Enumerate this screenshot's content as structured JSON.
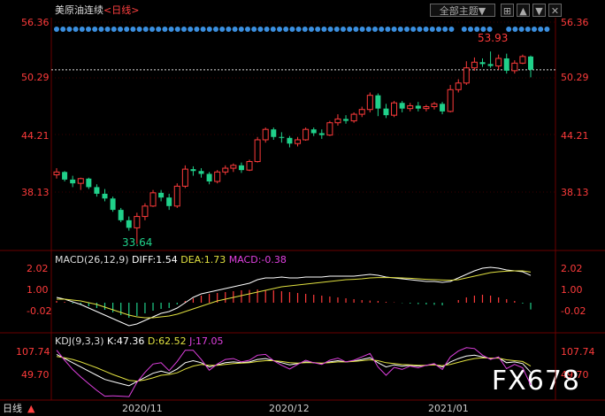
{
  "header": {
    "title": "美原油连续",
    "period": "<日线>",
    "theme_button": "全部主题▼",
    "buttons": [
      "⊞",
      "▲",
      "▼",
      "✕"
    ]
  },
  "axes": {
    "left": [
      "56.36",
      "50.29",
      "44.21",
      "38.13"
    ],
    "right": [
      "56.36",
      "50.29",
      "44.21",
      "38.13"
    ],
    "x_labels": [
      "2020/11",
      "2020/12",
      "2021/01"
    ]
  },
  "price": {
    "high_label": "53.93",
    "low_label": "33.64",
    "last": 52.0
  },
  "macd": {
    "title": "MACD(26,12,9)",
    "diff": "DIFF:1.54",
    "dea": "DEA:1.73",
    "macd": "MACD:-0.38",
    "left": [
      "2.02",
      "1.00",
      "-0.02"
    ],
    "right": [
      "2.02",
      "1.00",
      "-0.02"
    ]
  },
  "kdj": {
    "title": "KDJ(9,3,3)",
    "k": "K:47.36",
    "d": "D:62.52",
    "j": "J:17.05",
    "left": [
      "107.74",
      "49.70"
    ],
    "right": [
      "107.74",
      "49.70"
    ]
  },
  "footer": {
    "tab": "日线"
  },
  "watermark": "FX678",
  "colors": {
    "up": "#ff3b3b",
    "down": "#20d08a",
    "dots": "#3b8fe0",
    "k": "#ffffff",
    "d": "#e0e040",
    "j": "#e040e0"
  },
  "chart_data": {
    "type": "candlestick",
    "ylim": [
      33.0,
      57.5
    ],
    "candles": [
      [
        40.9,
        41.6,
        40.5,
        41.2
      ],
      [
        41.2,
        41.3,
        40.2,
        40.4
      ],
      [
        40.4,
        40.8,
        39.6,
        40.0
      ],
      [
        40.0,
        40.6,
        39.3,
        40.5
      ],
      [
        40.5,
        40.6,
        39.4,
        39.6
      ],
      [
        39.6,
        39.9,
        38.6,
        38.9
      ],
      [
        38.9,
        39.4,
        38.1,
        38.4
      ],
      [
        38.4,
        38.6,
        37.0,
        37.2
      ],
      [
        37.2,
        37.4,
        35.9,
        36.1
      ],
      [
        36.1,
        36.5,
        35.0,
        35.3
      ],
      [
        35.3,
        36.9,
        33.6,
        36.5
      ],
      [
        36.5,
        37.9,
        36.1,
        37.6
      ],
      [
        37.6,
        39.3,
        37.5,
        39.0
      ],
      [
        39.0,
        39.3,
        38.1,
        38.5
      ],
      [
        38.5,
        38.9,
        37.2,
        37.6
      ],
      [
        37.6,
        40.0,
        37.4,
        39.7
      ],
      [
        39.7,
        41.9,
        39.5,
        41.5
      ],
      [
        41.5,
        41.8,
        40.8,
        41.3
      ],
      [
        41.3,
        41.6,
        40.6,
        41.0
      ],
      [
        41.0,
        41.2,
        39.9,
        40.2
      ],
      [
        40.2,
        41.4,
        40.0,
        41.2
      ],
      [
        41.2,
        41.9,
        40.9,
        41.6
      ],
      [
        41.6,
        42.1,
        41.2,
        41.9
      ],
      [
        41.9,
        42.2,
        41.1,
        41.4
      ],
      [
        41.4,
        42.5,
        41.3,
        42.3
      ],
      [
        42.3,
        44.9,
        42.2,
        44.6
      ],
      [
        44.6,
        45.9,
        44.3,
        45.7
      ],
      [
        45.7,
        45.9,
        44.6,
        44.9
      ],
      [
        44.9,
        45.4,
        44.3,
        44.8
      ],
      [
        44.8,
        45.0,
        43.8,
        44.2
      ],
      [
        44.2,
        44.9,
        43.9,
        44.6
      ],
      [
        44.6,
        45.9,
        44.5,
        45.7
      ],
      [
        45.7,
        45.9,
        45.0,
        45.3
      ],
      [
        45.3,
        45.7,
        44.7,
        45.1
      ],
      [
        45.1,
        46.6,
        45.0,
        46.4
      ],
      [
        46.4,
        47.3,
        46.1,
        46.8
      ],
      [
        46.8,
        47.2,
        46.3,
        46.6
      ],
      [
        46.6,
        47.5,
        46.4,
        47.3
      ],
      [
        47.3,
        48.1,
        47.0,
        47.8
      ],
      [
        47.8,
        49.6,
        47.5,
        49.3
      ],
      [
        49.3,
        49.5,
        47.1,
        47.9
      ],
      [
        47.9,
        48.4,
        46.9,
        47.2
      ],
      [
        47.2,
        48.7,
        47.0,
        48.5
      ],
      [
        48.5,
        48.7,
        47.5,
        47.9
      ],
      [
        47.9,
        48.5,
        47.6,
        48.2
      ],
      [
        48.2,
        48.6,
        47.6,
        47.9
      ],
      [
        47.9,
        48.3,
        47.6,
        48.1
      ],
      [
        48.1,
        48.6,
        47.8,
        48.4
      ],
      [
        48.4,
        48.6,
        47.3,
        47.6
      ],
      [
        47.6,
        50.4,
        47.5,
        49.9
      ],
      [
        49.9,
        51.0,
        49.6,
        50.6
      ],
      [
        50.6,
        52.9,
        50.4,
        52.2
      ],
      [
        52.2,
        53.3,
        51.9,
        52.8
      ],
      [
        52.8,
        53.2,
        52.3,
        52.6
      ],
      [
        52.6,
        53.93,
        52.2,
        52.4
      ],
      [
        52.4,
        53.6,
        52.0,
        53.2
      ],
      [
        53.2,
        53.7,
        51.6,
        51.9
      ],
      [
        51.9,
        53.0,
        51.6,
        52.7
      ],
      [
        52.7,
        53.6,
        52.6,
        53.4
      ],
      [
        53.4,
        53.5,
        51.2,
        52.0
      ]
    ],
    "macd_hist": [
      0.1,
      0.05,
      -0.05,
      -0.1,
      -0.2,
      -0.3,
      -0.4,
      -0.55,
      -0.7,
      -0.85,
      -0.75,
      -0.6,
      -0.45,
      -0.35,
      -0.3,
      -0.1,
      0.1,
      0.25,
      0.4,
      0.5,
      0.55,
      0.6,
      0.65,
      0.7,
      0.72,
      0.75,
      0.72,
      0.7,
      0.65,
      0.6,
      0.55,
      0.5,
      0.45,
      0.4,
      0.35,
      0.3,
      0.25,
      0.2,
      0.15,
      0.12,
      0.1,
      0.05,
      0.02,
      -0.02,
      -0.05,
      -0.08,
      -0.1,
      -0.12,
      -0.15,
      0.0,
      0.15,
      0.3,
      0.4,
      0.45,
      0.4,
      0.3,
      0.2,
      0.1,
      -0.05,
      -0.38
    ],
    "diff": [
      0.3,
      0.2,
      0.05,
      -0.1,
      -0.3,
      -0.5,
      -0.7,
      -0.9,
      -1.1,
      -1.3,
      -1.2,
      -1.0,
      -0.8,
      -0.6,
      -0.5,
      -0.3,
      0.0,
      0.3,
      0.5,
      0.6,
      0.7,
      0.8,
      0.9,
      1.0,
      1.1,
      1.3,
      1.4,
      1.4,
      1.45,
      1.4,
      1.4,
      1.45,
      1.45,
      1.45,
      1.5,
      1.5,
      1.5,
      1.5,
      1.55,
      1.6,
      1.55,
      1.45,
      1.4,
      1.35,
      1.3,
      1.25,
      1.2,
      1.2,
      1.15,
      1.2,
      1.4,
      1.6,
      1.8,
      1.95,
      2.0,
      1.95,
      1.85,
      1.8,
      1.75,
      1.54
    ],
    "dea": [
      0.2,
      0.2,
      0.15,
      0.1,
      0.0,
      -0.1,
      -0.25,
      -0.4,
      -0.55,
      -0.7,
      -0.8,
      -0.85,
      -0.85,
      -0.8,
      -0.75,
      -0.65,
      -0.5,
      -0.35,
      -0.2,
      -0.05,
      0.1,
      0.2,
      0.3,
      0.4,
      0.5,
      0.6,
      0.7,
      0.8,
      0.9,
      0.95,
      1.0,
      1.05,
      1.1,
      1.15,
      1.2,
      1.25,
      1.3,
      1.32,
      1.35,
      1.4,
      1.42,
      1.42,
      1.42,
      1.4,
      1.38,
      1.35,
      1.32,
      1.3,
      1.28,
      1.27,
      1.3,
      1.4,
      1.5,
      1.6,
      1.7,
      1.75,
      1.78,
      1.8,
      1.8,
      1.73
    ],
    "k": [
      90,
      80,
      70,
      60,
      50,
      40,
      30,
      25,
      20,
      15,
      25,
      35,
      45,
      50,
      45,
      55,
      70,
      75,
      70,
      60,
      65,
      70,
      72,
      70,
      72,
      78,
      80,
      75,
      70,
      65,
      68,
      72,
      70,
      68,
      72,
      75,
      72,
      74,
      78,
      82,
      70,
      60,
      65,
      62,
      64,
      62,
      64,
      66,
      60,
      72,
      80,
      86,
      88,
      84,
      80,
      82,
      70,
      72,
      68,
      47
    ],
    "d": [
      85,
      82,
      78,
      72,
      65,
      58,
      50,
      42,
      35,
      28,
      26,
      29,
      34,
      40,
      42,
      46,
      55,
      62,
      66,
      64,
      64,
      66,
      68,
      69,
      70,
      73,
      75,
      75,
      73,
      70,
      69,
      70,
      70,
      69,
      70,
      72,
      72,
      73,
      75,
      77,
      75,
      70,
      68,
      66,
      65,
      64,
      64,
      65,
      63,
      66,
      71,
      76,
      80,
      82,
      81,
      81,
      77,
      75,
      73,
      62
    ],
    "j": [
      100,
      76,
      54,
      36,
      20,
      4,
      -10,
      -9,
      -10,
      -11,
      23,
      47,
      67,
      70,
      51,
      73,
      100,
      100,
      78,
      52,
      67,
      78,
      80,
      72,
      76,
      88,
      90,
      75,
      64,
      55,
      66,
      76,
      70,
      66,
      76,
      81,
      72,
      76,
      84,
      92,
      60,
      40,
      59,
      54,
      62,
      58,
      64,
      68,
      54,
      84,
      98,
      106,
      104,
      88,
      78,
      84,
      56,
      66,
      58,
      17
    ]
  }
}
